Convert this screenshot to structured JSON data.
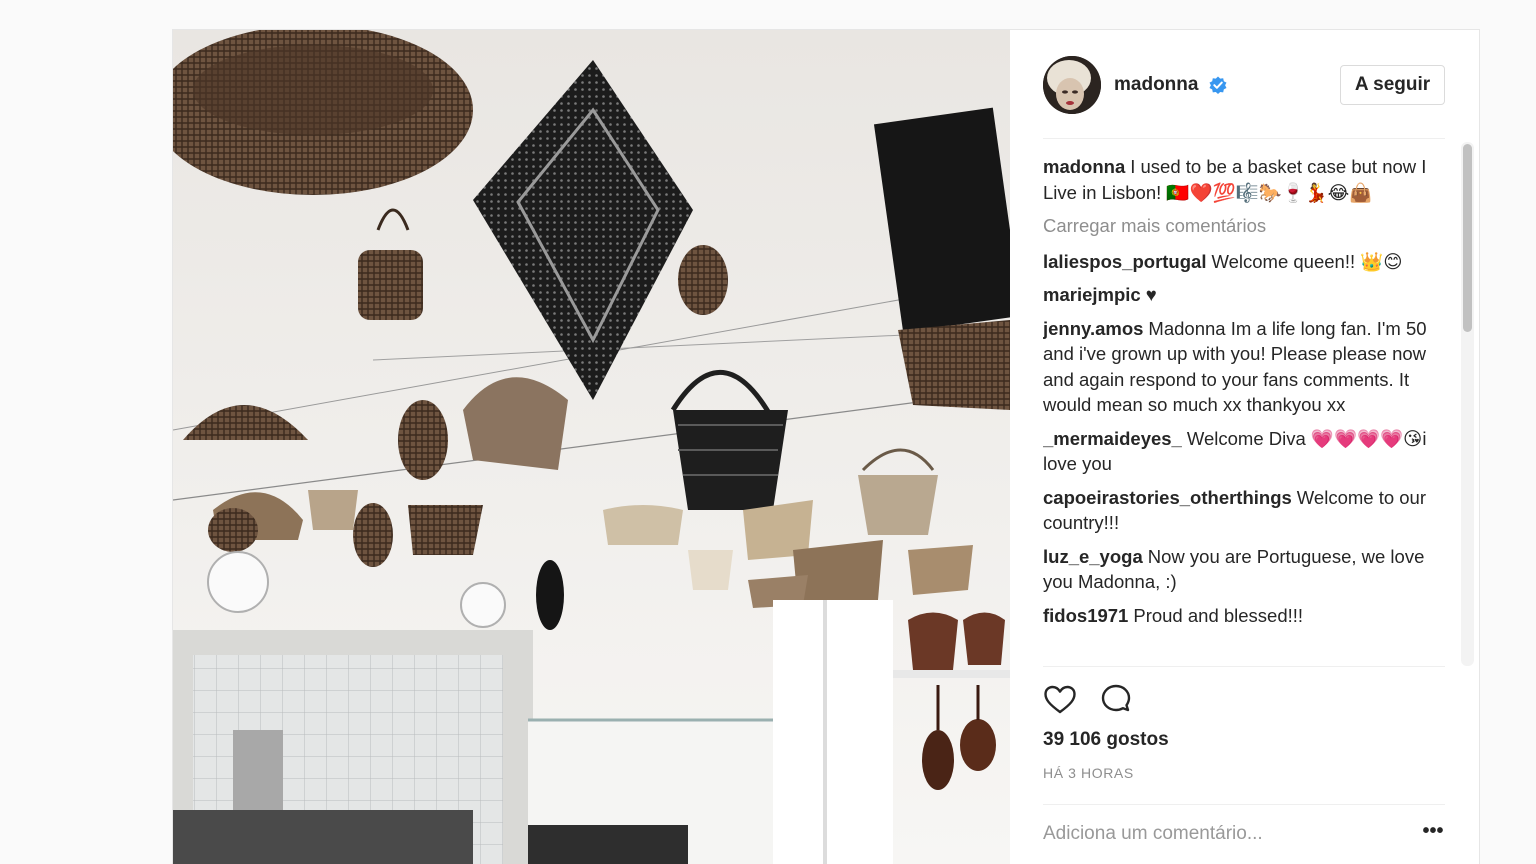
{
  "post": {
    "image_alt": "Hanging baskets in a kitchen",
    "user": {
      "name": "madonna",
      "verified": true
    },
    "follow_label": "A seguir",
    "caption": {
      "user": "madonna",
      "text": "I used to be a basket case but now I Live in Lisbon! 🇵🇹❤️💯🎼🐎🍷💃😂👜"
    },
    "load_more_label": "Carregar mais comentários",
    "comments": [
      {
        "user": "laliespos_portugal",
        "text": "Welcome queen!! 👑😊"
      },
      {
        "user": "mariejmpic",
        "text": "♥"
      },
      {
        "user": "jenny.amos",
        "text": "Madonna Im a life long fan. I'm 50 and i've grown up with you! Please please now and again respond to your fans comments. It would mean so much xx thankyou xx"
      },
      {
        "user": "_mermaideyes_",
        "text": "Welcome Diva 💗💗💗💗😘i love you"
      },
      {
        "user": "capoeirastories_otherthings",
        "text": "Welcome to our country!!!"
      },
      {
        "user": "luz_e_yoga",
        "text": "Now you are Portuguese, we love you Madonna, :)"
      },
      {
        "user": "fidos1971",
        "text": "Proud and blessed!!!"
      }
    ],
    "likes": "39 106 gostos",
    "timestamp": "HÁ 3 HORAS",
    "add_comment_placeholder": "Adiciona um comentário...",
    "more_options": "•••"
  },
  "colors": {
    "verified_blue": "#3897f0",
    "text": "#262626",
    "muted": "#8e8e8e",
    "border": "#efefef"
  },
  "icons": [
    "verified-badge-icon",
    "heart-icon",
    "comment-bubble-icon",
    "more-options-icon"
  ]
}
